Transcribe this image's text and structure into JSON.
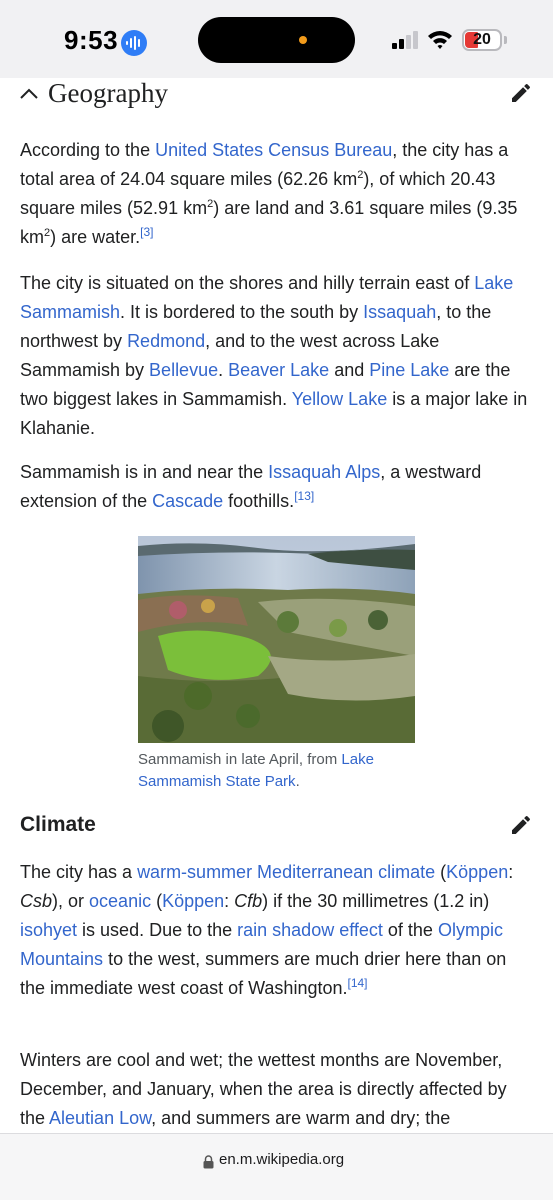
{
  "status_bar": {
    "time": "9:53",
    "battery": "20",
    "icons": [
      "siri-icon",
      "signal-icon",
      "wifi-icon",
      "battery-icon"
    ],
    "colors": {
      "siri": "#2f7df6",
      "battery_low": "#e53935",
      "island_dot": "#f29b1b"
    }
  },
  "geography": {
    "title": "Geography",
    "p1": {
      "t1": "According to the ",
      "link1": "United States Census Bureau",
      "t2": ", the city has a total area of 24.04 square miles (62.26 km",
      "sup1": "2",
      "t3": "), of which 20.43 square miles (52.91 km",
      "sup2": "2",
      "t4": ") are land and 3.61 square miles (9.35 km",
      "sup3": "2",
      "t5": ") are water.",
      "ref": "[3]"
    },
    "p2": {
      "t1": "The city is situated on the shores and hilly terrain east of ",
      "link1": "Lake Sammamish",
      "t2": ". It is bordered to the south by ",
      "link2": "Issaquah",
      "t3": ", to the northwest by ",
      "link3": "Redmond",
      "t4": ", and to the west across Lake Sammamish by ",
      "link4": "Bellevue",
      "t5": ". ",
      "link5": "Beaver Lake",
      "t6": " and ",
      "link6": "Pine Lake",
      "t7": " are the two biggest lakes in Sammamish. ",
      "link7": "Yellow Lake",
      "t8": " is a major lake in Klahanie."
    },
    "p3": {
      "t1": "Sammamish is in and near the ",
      "link1": "Issaquah Alps",
      "t2": ", a westward extension of the ",
      "link2": "Cascade",
      "t3": " foothills.",
      "ref": "[13]"
    },
    "figure": {
      "caption_text": "Sammamish in late April, from ",
      "caption_link": "Lake Sammamish State Park",
      "caption_end": "."
    }
  },
  "climate": {
    "title": "Climate",
    "p1": {
      "t1": "The city has a ",
      "link1": "warm-summer Mediterranean climate",
      "t2": " (",
      "link2": "Köppen",
      "t3": ": ",
      "i1": "Csb",
      "t4": "), or ",
      "link3": "oceanic",
      "t5": " (",
      "link4": "Köppen",
      "t6": ": ",
      "i2": "Cfb",
      "t7": ") if the 30 millimetres (1.2 in) ",
      "link5": "isohyet",
      "t8": " is used. Due to the ",
      "link6": "rain shadow effect",
      "t9": " of the ",
      "link7": "Olympic Mountains",
      "t10": " to the west, summers are much drier here than on the immediate west coast of Washington.",
      "ref": "[14]"
    },
    "p2": {
      "t1": "Winters are cool and wet; the wettest months are November, December, and January, when the area is directly affected by the ",
      "link1": "Aleutian Low",
      "t2": ", and summers are warm and dry; the"
    }
  },
  "browser": {
    "url": "en.m.wikipedia.org",
    "link_color": "#3366cc"
  }
}
